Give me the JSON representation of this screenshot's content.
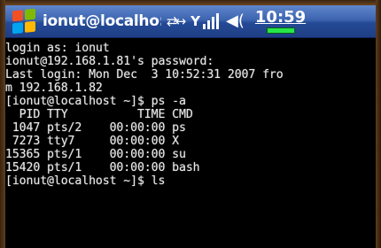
{
  "titlebar": {
    "title": "ionut@localho:",
    "time": "10:59",
    "icons": [
      "windows-start-icon",
      "sync-icon",
      "signal-icon",
      "speaker-icon",
      "battery-icon"
    ],
    "colors": {
      "titlebar": "#3d65b0",
      "battery": "#26e64a"
    }
  },
  "terminal": {
    "background": "#000000",
    "foreground": "#e8e8e8",
    "lines": [
      "login as: ionut",
      "ionut@192.168.1.81's password:",
      "Last login: Mon Dec  3 10:52:31 2007 fro",
      "m 192.168.1.82",
      "[ionut@localhost ~]$ ps -a",
      "  PID TTY          TIME CMD",
      " 1047 pts/2    00:00:00 ps",
      " 7273 tty7     00:00:00 X",
      "15365 pts/1    00:00:00 su",
      "15420 pts/1    00:00:00 bash",
      "[ionut@localhost ~]$ ls"
    ]
  }
}
